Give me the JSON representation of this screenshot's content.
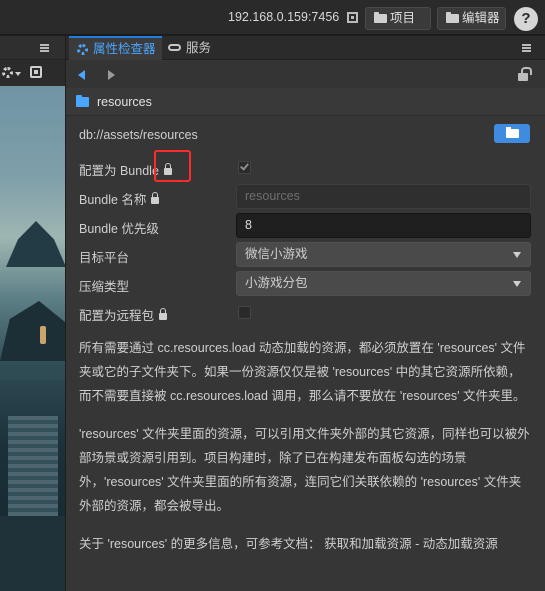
{
  "topbar": {
    "address": "192.168.0.159:7456",
    "project_label": "项目",
    "editor_label": "编辑器",
    "help_label": "?"
  },
  "inspector": {
    "tabs": [
      {
        "label": "属性检查器",
        "active": true
      },
      {
        "label": "服务",
        "active": false
      }
    ],
    "asset_name": "resources",
    "path": "db://assets/resources",
    "fields": {
      "bundle_label": "配置为 Bundle",
      "bundle_checked": true,
      "bundle_name_label": "Bundle 名称",
      "bundle_name_value": "resources",
      "priority_label": "Bundle 优先级",
      "priority_value": "8",
      "target_label": "目标平台",
      "target_value": "微信小游戏",
      "compress_label": "压缩类型",
      "compress_value": "小游戏分包",
      "remote_label": "配置为远程包",
      "remote_checked": false
    },
    "description": {
      "p1": "所有需要通过 cc.resources.load 动态加载的资源，都必须放置在 'resources' 文件夹或它的子文件夹下。如果一份资源仅仅是被 'resources' 中的其它资源所依赖，而不需要直接被 cc.resources.load 调用，那么请不要放在 'resources' 文件夹里。",
      "p2": "'resources' 文件夹里面的资源，可以引用文件夹外部的其它资源，同样也可以被外部场景或资源引用到。项目构建时，除了已在构建发布面板勾选的场景外，'resources' 文件夹里面的所有资源，连同它们关联依赖的 'resources' 文件夹外部的资源，都会被导出。",
      "p3_prefix": "关于 'resources' 的更多信息，可参考文档：",
      "p3_link": "获取和加载资源 - 动态加载资源"
    }
  },
  "colors": {
    "accent": "#4aa6ff",
    "highlight": "#ff2a2a",
    "panel_bg": "#363636"
  }
}
